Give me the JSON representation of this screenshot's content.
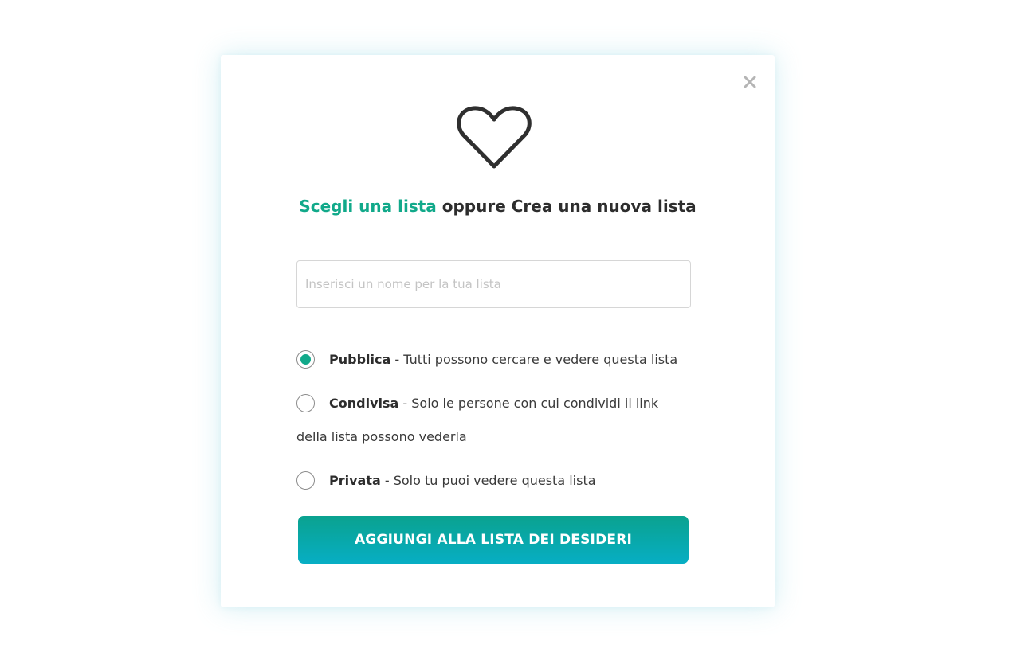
{
  "modal": {
    "title_link": "Scegli una lista",
    "title_rest": " oppure Crea una nuova lista",
    "close_label": "×",
    "input": {
      "placeholder": "Inserisci un nome per la tua lista",
      "value": ""
    },
    "options": [
      {
        "label": "Pubblica",
        "description": " - Tutti possono cercare e vedere questa lista",
        "checked": true
      },
      {
        "label": "Condivisa",
        "description": " - Solo le persone con cui condividi il link",
        "description_cont": "della lista possono vederla",
        "checked": false
      },
      {
        "label": "Privata",
        "description": " - Solo tu puoi vedere questa lista",
        "checked": false
      }
    ],
    "submit_label": "AGGIUNGI ALLA LISTA DEI DESIDERI"
  },
  "colors": {
    "accent": "#11a98a",
    "button_top": "#0aa28f",
    "button_bottom": "#07aec4",
    "text": "#333333"
  },
  "icons": {
    "header": "heart-icon",
    "close": "close-icon"
  }
}
